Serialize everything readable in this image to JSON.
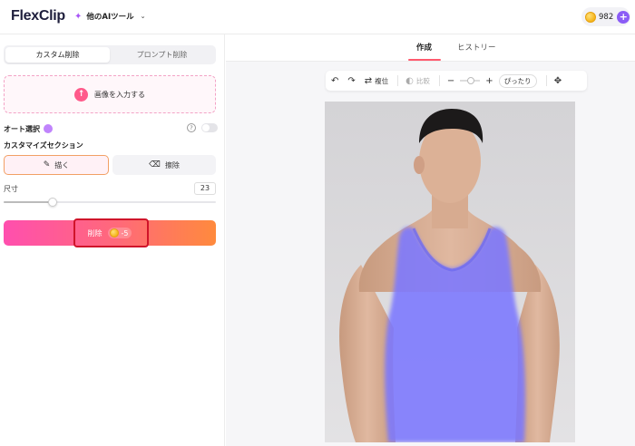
{
  "header": {
    "logo_text": "FlexClip",
    "tools_menu_label": "他のAIツール",
    "credits": "982"
  },
  "left_panel": {
    "tabs": [
      {
        "label": "カスタム削除",
        "active": true
      },
      {
        "label": "プロンプト削除",
        "active": false
      }
    ],
    "upload_label": "画像を入力する",
    "auto_select_label": "オート選択",
    "auto_select_on": false,
    "section_title": "カスタマイズセクション",
    "modes": [
      {
        "label": "描く",
        "icon": "pencil-icon",
        "active": true
      },
      {
        "label": "擦除",
        "icon": "eraser-icon",
        "active": false
      }
    ],
    "size_label": "尺寸",
    "size_value": "23",
    "size_level_percent": 23,
    "remove_button_label": "削除",
    "remove_cost": "-5"
  },
  "right_panel": {
    "tabs": [
      {
        "label": "作成",
        "active": true
      },
      {
        "label": "ヒストリー",
        "active": false
      }
    ],
    "toolbar": {
      "undo_icon": "undo-icon",
      "redo_icon": "redo-icon",
      "restore_label": "複位",
      "compare_label": "比較",
      "fit_label": "ぴったり"
    }
  },
  "colors": {
    "accent_pink": "#ff4fae",
    "accent_orange": "#ff8a3d",
    "mask_purple": "#7b78ff",
    "highlight_red": "#d0142a"
  }
}
